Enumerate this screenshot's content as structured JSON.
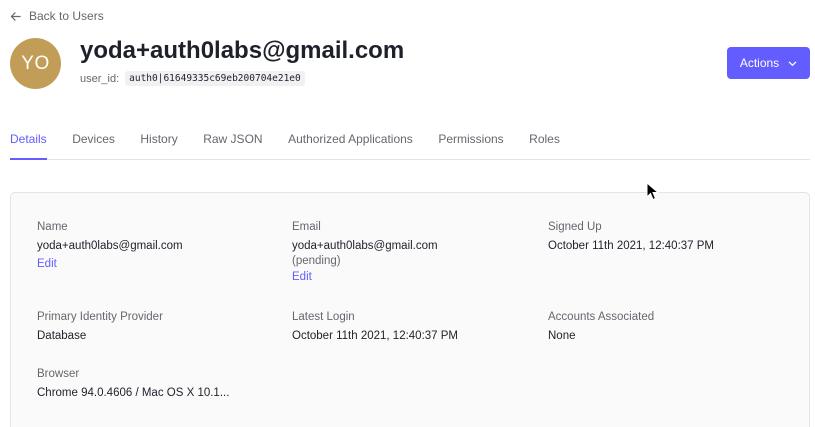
{
  "nav": {
    "back_label": "Back to Users"
  },
  "user": {
    "avatar_initials": "YO",
    "avatar_color": "#c29d57",
    "title": "yoda+auth0labs@gmail.com",
    "user_id_label": "user_id:",
    "user_id_value": "auth0|61649335c69eb200704e21e0"
  },
  "actions": {
    "label": "Actions",
    "color": "#635dff"
  },
  "tabs": [
    {
      "label": "Details",
      "active": true
    },
    {
      "label": "Devices"
    },
    {
      "label": "History"
    },
    {
      "label": "Raw JSON"
    },
    {
      "label": "Authorized Applications"
    },
    {
      "label": "Permissions"
    },
    {
      "label": "Roles"
    }
  ],
  "details": {
    "name": {
      "label": "Name",
      "value": "yoda+auth0labs@gmail.com",
      "edit": "Edit"
    },
    "email": {
      "label": "Email",
      "value": "yoda+auth0labs@gmail.com",
      "status": "(pending)",
      "edit": "Edit"
    },
    "signed_up": {
      "label": "Signed Up",
      "value": "October 11th 2021, 12:40:37 PM"
    },
    "identity_provider": {
      "label": "Primary Identity Provider",
      "value": "Database"
    },
    "latest_login": {
      "label": "Latest Login",
      "value": "October 11th 2021, 12:40:37 PM"
    },
    "accounts": {
      "label": "Accounts Associated",
      "value": "None"
    },
    "browser": {
      "label": "Browser",
      "value": "Chrome 94.0.4606 / Mac OS X 10.1..."
    }
  }
}
